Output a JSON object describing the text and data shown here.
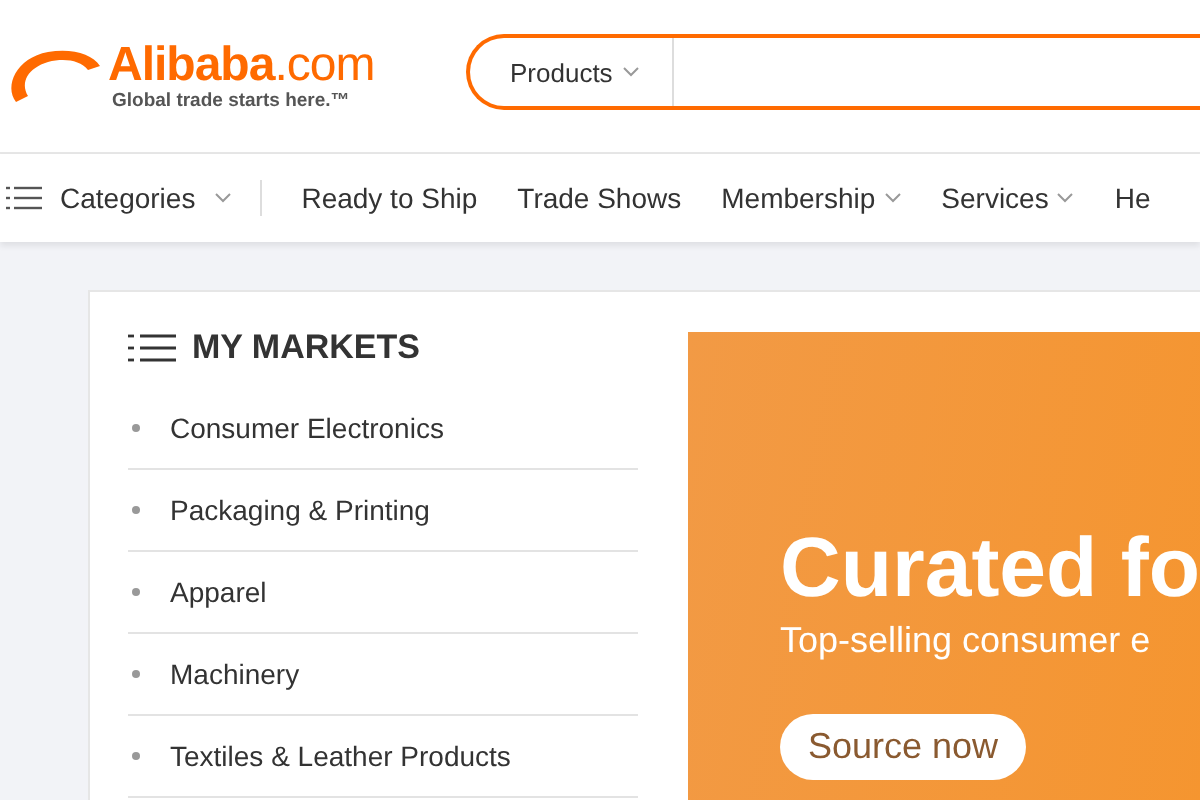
{
  "logo": {
    "name": "**Alibaba**.com",
    "tagline": "Global trade starts here.™"
  },
  "search": {
    "category": "Products"
  },
  "nav": [
    {
      "label": "Categories",
      "kind": "menu",
      "dropdown": true
    },
    {
      "label": "Ready to Ship",
      "kind": "link",
      "dropdown": false
    },
    {
      "label": "Trade Shows",
      "kind": "link",
      "dropdown": false
    },
    {
      "label": "Membership",
      "kind": "link",
      "dropdown": true
    },
    {
      "label": "Services",
      "kind": "link",
      "dropdown": true
    },
    {
      "label": "He",
      "kind": "link",
      "dropdown": false
    }
  ],
  "markets": {
    "title": "MY MARKETS",
    "items": [
      "Consumer Electronics",
      "Packaging & Printing",
      "Apparel",
      "Machinery",
      "Textiles & Leather Products"
    ]
  },
  "banner": {
    "headline": "Curated fo",
    "subtitle": "Top-selling consumer e",
    "button": "Source now"
  }
}
